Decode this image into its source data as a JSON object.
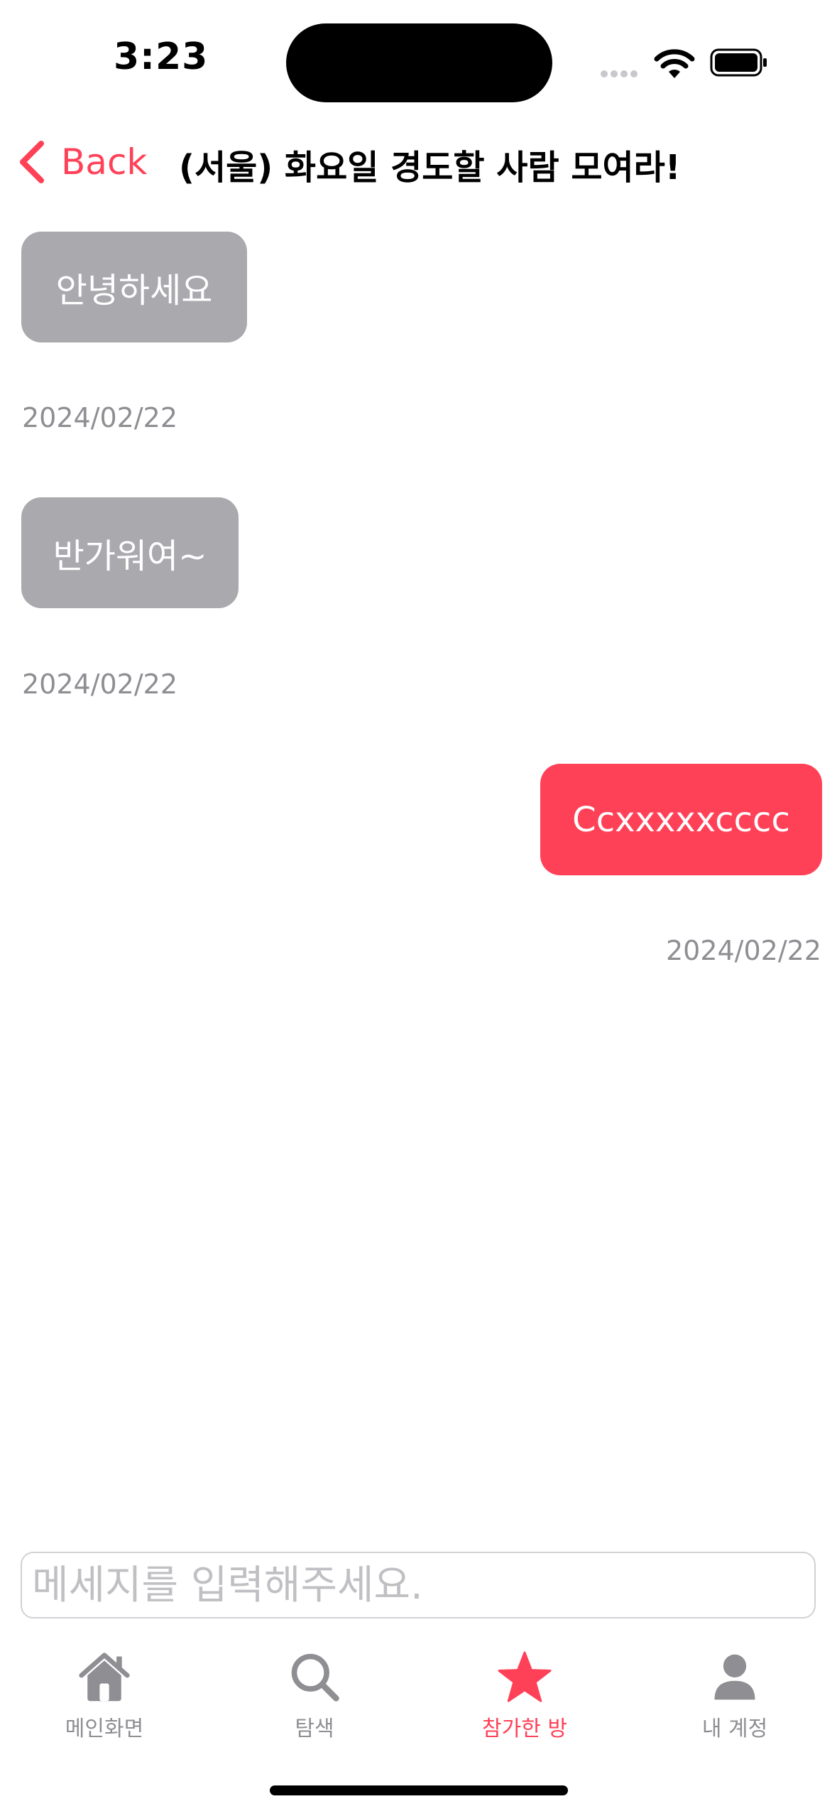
{
  "status_bar": {
    "time": "3:23"
  },
  "nav": {
    "back_label": "Back",
    "title": "(서울) 화요일 경도할 사람 모여라!"
  },
  "messages": [
    {
      "sender": "other",
      "text": "안녕하세요",
      "date": "2024/02/22"
    },
    {
      "sender": "other",
      "text": "반가워여~",
      "date": "2024/02/22"
    },
    {
      "sender": "me",
      "text": "Ccxxxxxcccc",
      "date": "2024/02/22"
    }
  ],
  "input": {
    "placeholder": "메세지를 입력해주세요.",
    "value": ""
  },
  "tabs": [
    {
      "label": "메인화면",
      "icon": "house-icon",
      "active": false
    },
    {
      "label": "탐색",
      "icon": "magnifier-icon",
      "active": false
    },
    {
      "label": "참가한 방",
      "icon": "star-icon",
      "active": true
    },
    {
      "label": "내 계정",
      "icon": "person-icon",
      "active": false
    }
  ],
  "colors": {
    "accent": "#ff4158",
    "incoming_bubble": "#a9a9ae",
    "inactive": "#8e8e93"
  }
}
